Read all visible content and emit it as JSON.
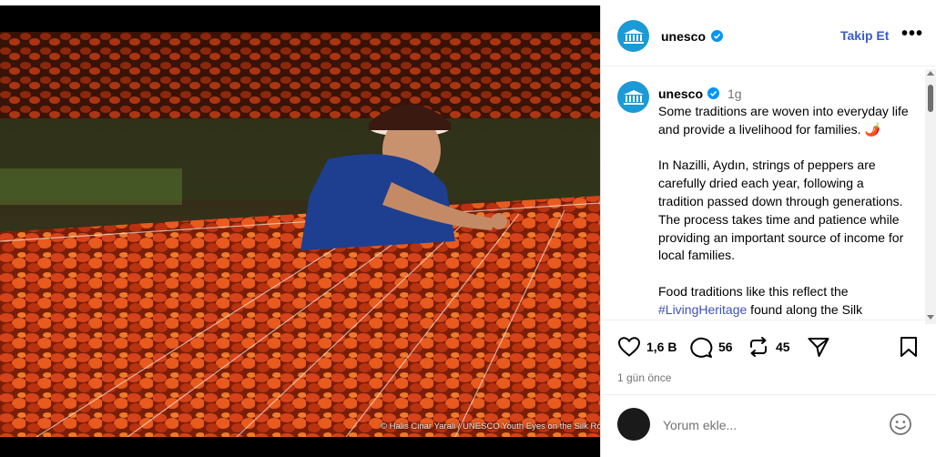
{
  "media": {
    "photo_credit": "© Halis Cinar Yarali / UNESCO Youth Eyes on the Silk Roads"
  },
  "header": {
    "username": "unesco",
    "follow_label": "Takip Et",
    "more_label": "•••"
  },
  "caption": {
    "username": "unesco",
    "time_short": "1g",
    "paragraph_1": "Some traditions are woven into everyday life and provide a livelihood for families. 🌶️",
    "paragraph_2": "In Nazilli, Aydın, strings of peppers are carefully dried each year, following a tradition passed down through generations. The process takes time and patience while providing an important source of income for local families.",
    "paragraph_3_start": "Food traditions like this reflect the ",
    "paragraph_3_tag": "#LivingHeritage",
    "paragraph_3_end": " found along the Silk"
  },
  "actions": {
    "likes": "1,6 B",
    "comments": "56",
    "reposts": "45",
    "date": "1 gün önce"
  },
  "comment_box": {
    "placeholder": "Yorum ekle..."
  },
  "colors": {
    "accent_follow": "#3a5bcb",
    "unesco_blue": "#1b9ad6",
    "verified_blue": "#0095f6"
  }
}
